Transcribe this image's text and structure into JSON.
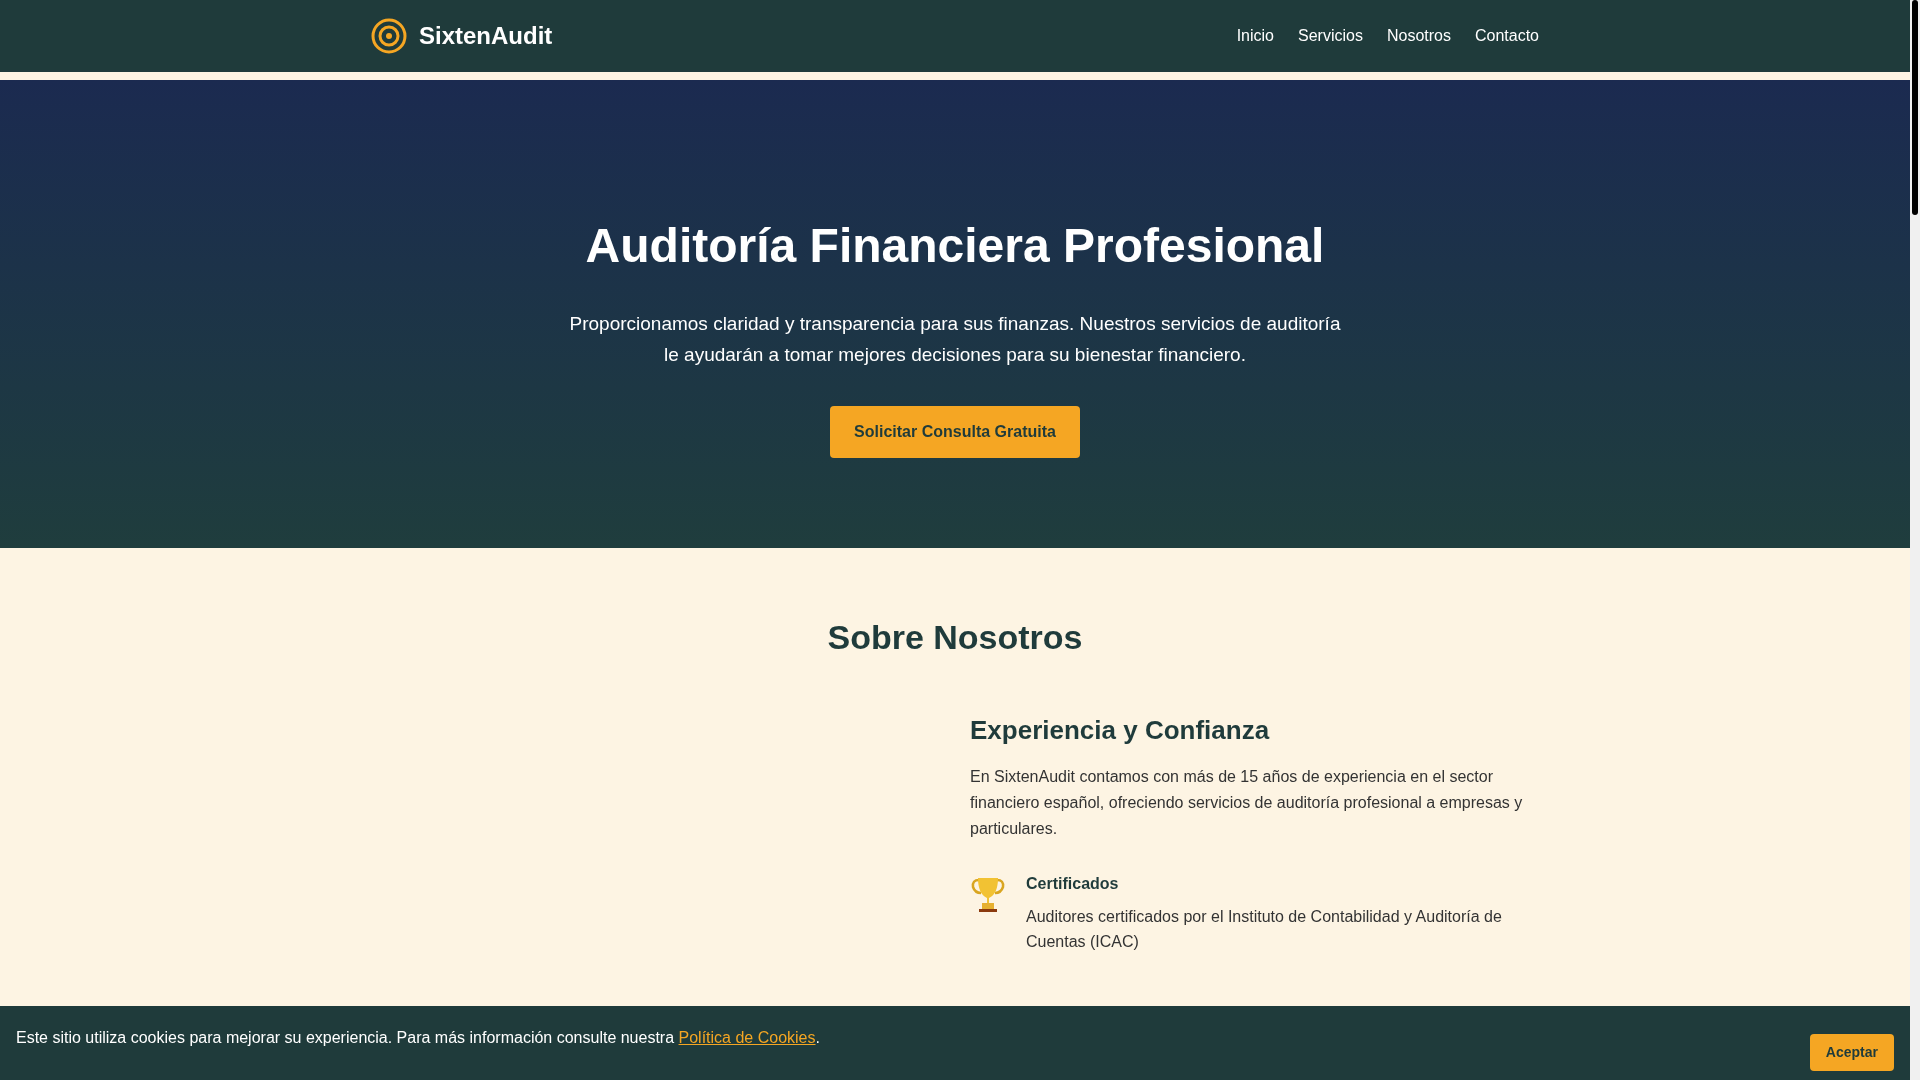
{
  "header": {
    "brand": "SixtenAudit",
    "nav": [
      {
        "label": "Inicio"
      },
      {
        "label": "Servicios"
      },
      {
        "label": "Nosotros"
      },
      {
        "label": "Contacto"
      }
    ]
  },
  "hero": {
    "title": "Auditoría Financiera Profesional",
    "text": "Proporcionamos claridad y transparencia para sus finanzas. Nuestros servicios de auditoría le ayudarán a tomar mejores decisiones para su bienestar financiero.",
    "button": "Solicitar Consulta Gratuita"
  },
  "about": {
    "title": "Sobre Nosotros",
    "subtitle": "Experiencia y Confianza",
    "text": "En SixtenAudit contamos con más de 15 años de experiencia en el sector financiero español, ofreciendo servicios de auditoría profesional a empresas y particulares.",
    "features": [
      {
        "title": "Certificados",
        "text": "Auditores certificados por el Instituto de Contabilidad y Auditoría de Cuentas (ICAC)"
      }
    ]
  },
  "cookie_bar": {
    "text": "Este sitio utiliza cookies para mejorar su experiencia. Para más información consulte nuestra",
    "link": "Política de Cookies",
    "end": ".",
    "button": "Aceptar"
  }
}
